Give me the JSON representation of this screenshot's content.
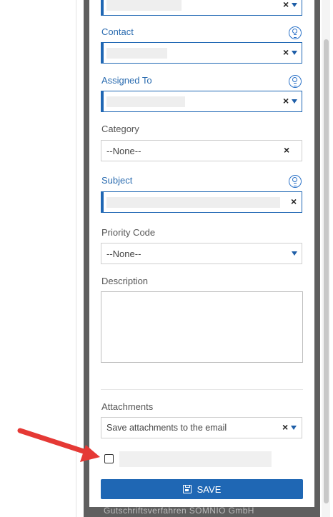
{
  "form": {
    "contact_label": "Contact",
    "assigned_to_label": "Assigned To",
    "category_label": "Category",
    "category_value": "--None--",
    "subject_label": "Subject",
    "priority_label": "Priority Code",
    "priority_value": "--None--",
    "description_label": "Description",
    "description_value": "",
    "attachments_label": "Attachments",
    "attachments_value": "Save attachments to the email",
    "save_label": "SAVE",
    "clear_glyph": "×"
  },
  "bottom_text": "Gutschriftsverfahren SOMNIO GmbH",
  "colors": {
    "accent": "#1f67b4",
    "label_active": "#2b6cb0",
    "annotation_arrow": "#e53935"
  },
  "icons": [
    "lightbulb-icon",
    "clear-icon",
    "chevron-down-icon",
    "save-icon",
    "arrow-icon"
  ]
}
